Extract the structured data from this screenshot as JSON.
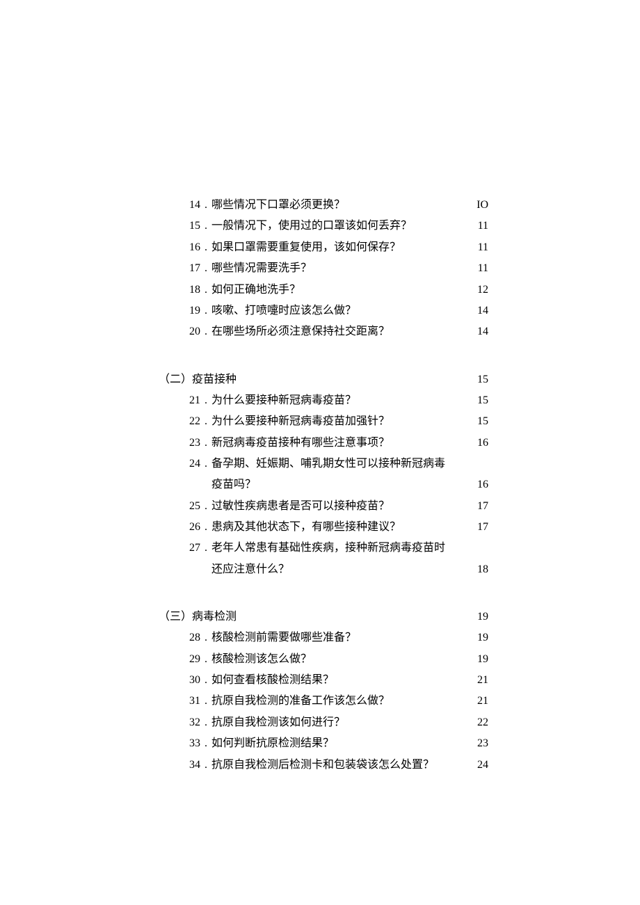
{
  "sections": [
    {
      "label": "",
      "page": "",
      "entries": [
        {
          "num": "14",
          "text": "哪些情况下口罩必须更换？",
          "page": "IO"
        },
        {
          "num": "15",
          "text": "一般情况下，使用过的口罩该如何丢弃？",
          "page": "11"
        },
        {
          "num": "16",
          "text": "如果口罩需要重复使用，该如何保存？",
          "page": "11"
        },
        {
          "num": "17",
          "text": "哪些情况需要洗手？",
          "page": "11"
        },
        {
          "num": "18",
          "text": "如何正确地洗手？",
          "page": "12"
        },
        {
          "num": "19",
          "text": "咳嗽、打喷嚏时应该怎么做？",
          "page": "14"
        },
        {
          "num": "20",
          "text": "在哪些场所必须注意保持社交距离？",
          "page": "14"
        }
      ]
    },
    {
      "label": "（二）疫苗接种",
      "page": "15",
      "entries": [
        {
          "num": "21",
          "text": "为什么要接种新冠病毒疫苗？",
          "page": "15"
        },
        {
          "num": "22",
          "text": "为什么要接种新冠病毒疫苗加强针？",
          "page": "15"
        },
        {
          "num": "23",
          "text": "新冠病毒疫苗接种有哪些注意事项？",
          "page": "16"
        },
        {
          "num": "24",
          "text": "备孕期、妊娠期、哺乳期女性可以接种新冠病毒",
          "cont": "疫苗吗？",
          "page": "16"
        },
        {
          "num": "25",
          "text": "过敏性疾病患者是否可以接种疫苗？",
          "page": "17"
        },
        {
          "num": "26",
          "text": "患病及其他状态下，有哪些接种建议？",
          "page": "17"
        },
        {
          "num": "27",
          "text": "老年人常患有基础性疾病，接种新冠病毒疫苗时",
          "cont": "还应注意什么？",
          "page": "18"
        }
      ]
    },
    {
      "label": "（三）病毒检测",
      "page": "19",
      "entries": [
        {
          "num": "28",
          "text": "核酸检测前需要做哪些准备？",
          "page": "19"
        },
        {
          "num": "29",
          "text": "核酸检测该怎么做？",
          "page": "19"
        },
        {
          "num": "30",
          "text": "如何查看核酸检测结果？",
          "page": "21"
        },
        {
          "num": "31",
          "text": "抗原自我检测的准备工作该怎么做？",
          "page": "21"
        },
        {
          "num": "32",
          "text": "抗原自我检测该如何进行？",
          "page": "22"
        },
        {
          "num": "33",
          "text": "如何判断抗原检测结果？",
          "page": "23"
        },
        {
          "num": "34",
          "text": "抗原自我检测后检测卡和包装袋该怎么处置？",
          "page": "24"
        }
      ]
    }
  ]
}
